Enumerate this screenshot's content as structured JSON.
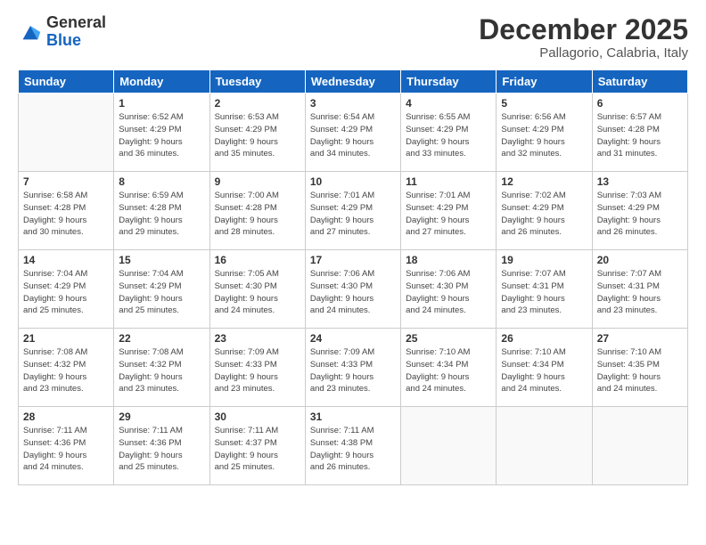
{
  "logo": {
    "general": "General",
    "blue": "Blue"
  },
  "title": "December 2025",
  "location": "Pallagorio, Calabria, Italy",
  "days_header": [
    "Sunday",
    "Monday",
    "Tuesday",
    "Wednesday",
    "Thursday",
    "Friday",
    "Saturday"
  ],
  "weeks": [
    [
      {
        "num": "",
        "info": ""
      },
      {
        "num": "1",
        "info": "Sunrise: 6:52 AM\nSunset: 4:29 PM\nDaylight: 9 hours\nand 36 minutes."
      },
      {
        "num": "2",
        "info": "Sunrise: 6:53 AM\nSunset: 4:29 PM\nDaylight: 9 hours\nand 35 minutes."
      },
      {
        "num": "3",
        "info": "Sunrise: 6:54 AM\nSunset: 4:29 PM\nDaylight: 9 hours\nand 34 minutes."
      },
      {
        "num": "4",
        "info": "Sunrise: 6:55 AM\nSunset: 4:29 PM\nDaylight: 9 hours\nand 33 minutes."
      },
      {
        "num": "5",
        "info": "Sunrise: 6:56 AM\nSunset: 4:29 PM\nDaylight: 9 hours\nand 32 minutes."
      },
      {
        "num": "6",
        "info": "Sunrise: 6:57 AM\nSunset: 4:28 PM\nDaylight: 9 hours\nand 31 minutes."
      }
    ],
    [
      {
        "num": "7",
        "info": "Sunrise: 6:58 AM\nSunset: 4:28 PM\nDaylight: 9 hours\nand 30 minutes."
      },
      {
        "num": "8",
        "info": "Sunrise: 6:59 AM\nSunset: 4:28 PM\nDaylight: 9 hours\nand 29 minutes."
      },
      {
        "num": "9",
        "info": "Sunrise: 7:00 AM\nSunset: 4:28 PM\nDaylight: 9 hours\nand 28 minutes."
      },
      {
        "num": "10",
        "info": "Sunrise: 7:01 AM\nSunset: 4:29 PM\nDaylight: 9 hours\nand 27 minutes."
      },
      {
        "num": "11",
        "info": "Sunrise: 7:01 AM\nSunset: 4:29 PM\nDaylight: 9 hours\nand 27 minutes."
      },
      {
        "num": "12",
        "info": "Sunrise: 7:02 AM\nSunset: 4:29 PM\nDaylight: 9 hours\nand 26 minutes."
      },
      {
        "num": "13",
        "info": "Sunrise: 7:03 AM\nSunset: 4:29 PM\nDaylight: 9 hours\nand 26 minutes."
      }
    ],
    [
      {
        "num": "14",
        "info": "Sunrise: 7:04 AM\nSunset: 4:29 PM\nDaylight: 9 hours\nand 25 minutes."
      },
      {
        "num": "15",
        "info": "Sunrise: 7:04 AM\nSunset: 4:29 PM\nDaylight: 9 hours\nand 25 minutes."
      },
      {
        "num": "16",
        "info": "Sunrise: 7:05 AM\nSunset: 4:30 PM\nDaylight: 9 hours\nand 24 minutes."
      },
      {
        "num": "17",
        "info": "Sunrise: 7:06 AM\nSunset: 4:30 PM\nDaylight: 9 hours\nand 24 minutes."
      },
      {
        "num": "18",
        "info": "Sunrise: 7:06 AM\nSunset: 4:30 PM\nDaylight: 9 hours\nand 24 minutes."
      },
      {
        "num": "19",
        "info": "Sunrise: 7:07 AM\nSunset: 4:31 PM\nDaylight: 9 hours\nand 23 minutes."
      },
      {
        "num": "20",
        "info": "Sunrise: 7:07 AM\nSunset: 4:31 PM\nDaylight: 9 hours\nand 23 minutes."
      }
    ],
    [
      {
        "num": "21",
        "info": "Sunrise: 7:08 AM\nSunset: 4:32 PM\nDaylight: 9 hours\nand 23 minutes."
      },
      {
        "num": "22",
        "info": "Sunrise: 7:08 AM\nSunset: 4:32 PM\nDaylight: 9 hours\nand 23 minutes."
      },
      {
        "num": "23",
        "info": "Sunrise: 7:09 AM\nSunset: 4:33 PM\nDaylight: 9 hours\nand 23 minutes."
      },
      {
        "num": "24",
        "info": "Sunrise: 7:09 AM\nSunset: 4:33 PM\nDaylight: 9 hours\nand 23 minutes."
      },
      {
        "num": "25",
        "info": "Sunrise: 7:10 AM\nSunset: 4:34 PM\nDaylight: 9 hours\nand 24 minutes."
      },
      {
        "num": "26",
        "info": "Sunrise: 7:10 AM\nSunset: 4:34 PM\nDaylight: 9 hours\nand 24 minutes."
      },
      {
        "num": "27",
        "info": "Sunrise: 7:10 AM\nSunset: 4:35 PM\nDaylight: 9 hours\nand 24 minutes."
      }
    ],
    [
      {
        "num": "28",
        "info": "Sunrise: 7:11 AM\nSunset: 4:36 PM\nDaylight: 9 hours\nand 24 minutes."
      },
      {
        "num": "29",
        "info": "Sunrise: 7:11 AM\nSunset: 4:36 PM\nDaylight: 9 hours\nand 25 minutes."
      },
      {
        "num": "30",
        "info": "Sunrise: 7:11 AM\nSunset: 4:37 PM\nDaylight: 9 hours\nand 25 minutes."
      },
      {
        "num": "31",
        "info": "Sunrise: 7:11 AM\nSunset: 4:38 PM\nDaylight: 9 hours\nand 26 minutes."
      },
      {
        "num": "",
        "info": ""
      },
      {
        "num": "",
        "info": ""
      },
      {
        "num": "",
        "info": ""
      }
    ]
  ]
}
